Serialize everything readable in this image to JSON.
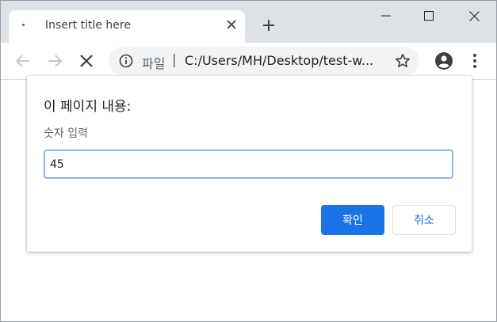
{
  "browser": {
    "tab": {
      "title": "Insert title here"
    },
    "omnibox": {
      "scheme_label": "파일",
      "separator": "|",
      "url": "C:/Users/MH/Desktop/test-w..."
    }
  },
  "dialog": {
    "title": "이 페이지 내용:",
    "message": "숫자 입력",
    "input_value": "45",
    "ok_label": "확인",
    "cancel_label": "취소"
  },
  "colors": {
    "accent": "#1a73e8",
    "tabstrip": "#dee1e6",
    "omnibox": "#f1f3f4"
  }
}
